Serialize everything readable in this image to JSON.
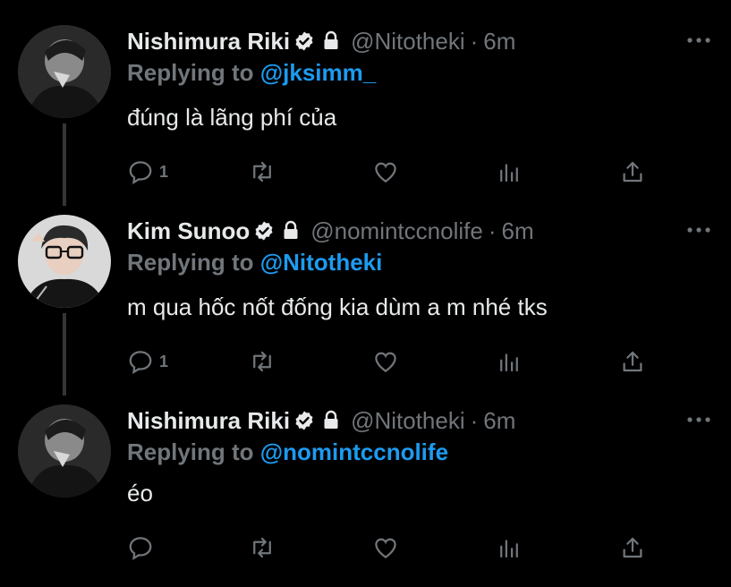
{
  "colors": {
    "background": "#000000",
    "text": "#e7e9ea",
    "muted": "#71767b",
    "accent": "#1d9bf0",
    "thread": "#333639"
  },
  "tweets": [
    {
      "name": "Nishimura Riki",
      "handle": "@Nitotheki",
      "separator": "·",
      "time": "6m",
      "replying_prefix": "Replying to ",
      "replying_to": "@jksimm_",
      "text": "đúng là lãng phí của",
      "reply_count": "1",
      "retweet_count": "",
      "like_count": "",
      "icons": [
        "verified-badge-icon",
        "lock-icon",
        "more-icon",
        "reply-icon",
        "retweet-icon",
        "like-icon",
        "analytics-icon",
        "share-icon"
      ]
    },
    {
      "name": "Kim Sunoo",
      "handle": "@nomintccnolife",
      "separator": "·",
      "time": "6m",
      "replying_prefix": "Replying to ",
      "replying_to": "@Nitotheki",
      "text": "m qua hốc nốt đống kia dùm a m nhé tks",
      "reply_count": "1",
      "retweet_count": "",
      "like_count": "",
      "icons": [
        "verified-badge-icon",
        "lock-icon",
        "more-icon",
        "reply-icon",
        "retweet-icon",
        "like-icon",
        "analytics-icon",
        "share-icon"
      ]
    },
    {
      "name": "Nishimura Riki",
      "handle": "@Nitotheki",
      "separator": "·",
      "time": "6m",
      "replying_prefix": "Replying to ",
      "replying_to": "@nomintccnolife",
      "text": "éo",
      "reply_count": "",
      "retweet_count": "",
      "like_count": "",
      "icons": [
        "verified-badge-icon",
        "lock-icon",
        "more-icon",
        "reply-icon",
        "retweet-icon",
        "like-icon",
        "analytics-icon",
        "share-icon"
      ]
    }
  ]
}
